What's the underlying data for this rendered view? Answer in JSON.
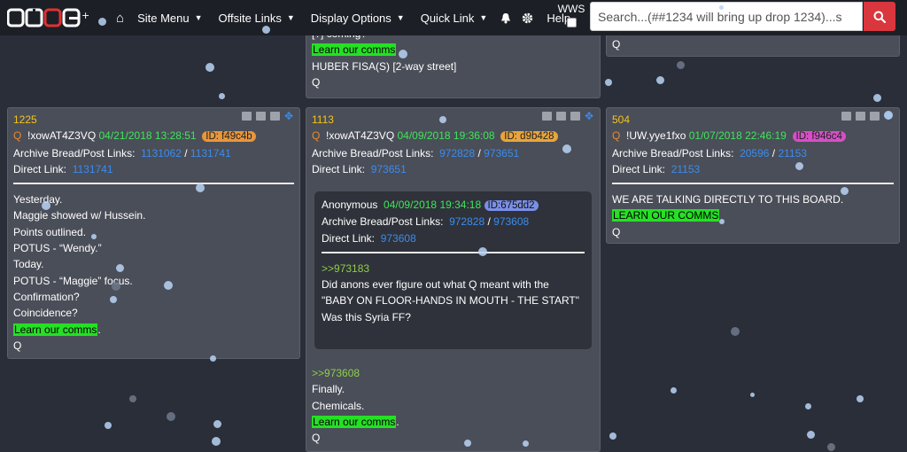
{
  "nav": {
    "logo_text": "QAGG",
    "site_menu": "Site Menu",
    "offsite_links": "Offsite Links",
    "display_options": "Display Options",
    "quick_link": "Quick Link",
    "help": "Help",
    "wws": "WWS",
    "search_placeholder": "Search...(##1234 will bring up drop 1234)...s"
  },
  "cards": {
    "top_mid": {
      "line0": "[?] coming?",
      "learn": "Learn our comms",
      "line2": "HUBER FISA(S) [2-way street]",
      "sig": "Q"
    },
    "top_right": {
      "sig": "Q"
    },
    "c1225": {
      "num": "1225",
      "q": "Q",
      "trip": "!xowAT4Z3VQ",
      "date": "04/21/2018 13:28:51",
      "id": "ID: f49c4b",
      "archive_label": "Archive Bread/Post Links:",
      "link1": "1131062",
      "link2": "1131741",
      "direct_label": "Direct Link:",
      "direct": "1131741",
      "lines": [
        "Yesterday.",
        "Maggie showed w/ Hussein.",
        "Points outlined.",
        "POTUS - “Wendy.”",
        "Today.",
        "POTUS - “Maggie” focus.",
        "Confirmation?",
        "Coincidence?"
      ],
      "learn": "Learn our comms",
      "sig": "Q"
    },
    "c1113": {
      "num": "1113",
      "q": "Q",
      "trip": "!xowAT4Z3VQ",
      "date": "04/09/2018 19:36:08",
      "id": "ID: d9b428",
      "archive_label": "Archive Bread/Post Links:",
      "link1": "972828",
      "link2": "973651",
      "direct_label": "Direct Link:",
      "direct": "973651",
      "quoted": {
        "author": "Anonymous",
        "date": "04/09/2018 19:34:18",
        "id": "ID:675dd2",
        "archive_label": "Archive Bread/Post Links:",
        "link1": "972828",
        "link2": "973608",
        "direct_label": "Direct Link:",
        "direct": "973608",
        "ref": ">>973183",
        "lines": [
          "Did anons ever figure out what Q meant with the",
          "\"BABY ON FLOOR-HANDS IN MOUTH - THE START\"",
          "Was this Syria FF?"
        ]
      },
      "ref": ">>973608",
      "lines": [
        "Finally.",
        "Chemicals."
      ],
      "learn": "Learn our comms",
      "sig": "Q"
    },
    "c504": {
      "num": "504",
      "q": "Q",
      "trip": "!UW.yye1fxo",
      "date": "01/07/2018 22:46:19",
      "id": "ID: f946c4",
      "archive_label": "Archive Bread/Post Links:",
      "link1": "20596",
      "link2": "21153",
      "direct_label": "Direct Link:",
      "direct": "21153",
      "line1": "WE ARE TALKING DIRECTLY TO THIS BOARD.",
      "learn": "LEARN OUR COMMS",
      "sig": "Q"
    }
  },
  "colors": {
    "accent_green": "#25e025",
    "link_blue": "#3a8cf0",
    "date_green": "#3ee65a",
    "search_red": "#d9363e"
  }
}
